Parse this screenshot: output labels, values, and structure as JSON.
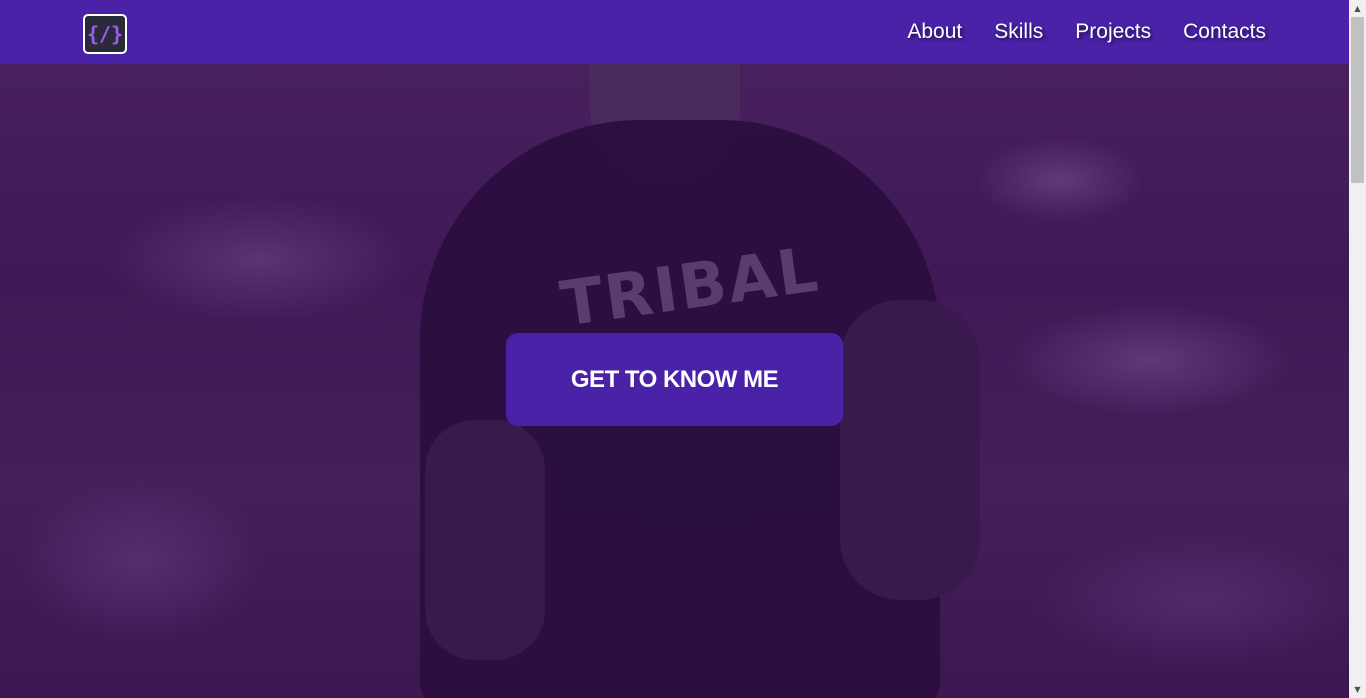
{
  "navbar": {
    "logo_text": "{/}",
    "links": [
      "About",
      "Skills",
      "Projects",
      "Contacts"
    ]
  },
  "hero": {
    "tshirt_text": "TRIBAL",
    "cta_label": "GET TO KNOW ME"
  },
  "colors": {
    "primary": "#4a22a8",
    "overlay": "#3f1a56",
    "text": "#ffffff",
    "logo_accent": "#9b5cf0"
  },
  "icons": {
    "scroll_up": "triangle-up-icon",
    "scroll_down": "triangle-down-icon"
  }
}
